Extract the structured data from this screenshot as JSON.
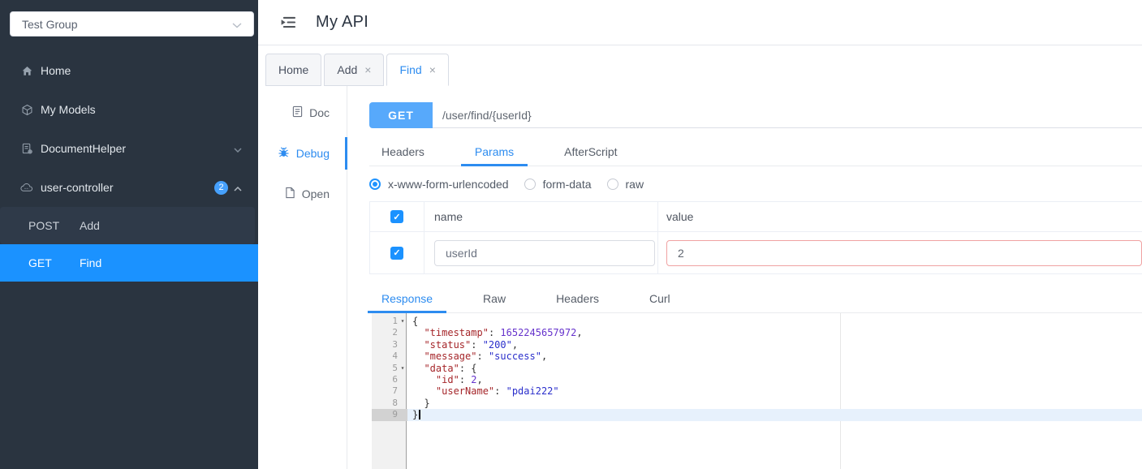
{
  "icons": {
    "close": "×",
    "check": "✓",
    "fold_marker": "▾"
  },
  "colors": {
    "sidebar_bg": "#2a3440",
    "submenu_item_bg": "#2f3a49",
    "sidebar_active_bg": "#1b92ff",
    "accent_blue": "#2d8cf0",
    "method_button_bg": "#57a9fb",
    "checkbox_blue": "#1b92ff",
    "badge_blue": "#46a0fc",
    "error_input_border": "#f0a2a2",
    "active_line_bg": "#e7f1fc",
    "syntax_key": "#a5262a",
    "syntax_string": "#2a2ecb",
    "syntax_number": "#6633cc"
  },
  "sidebar": {
    "group_select": {
      "value": "Test Group"
    },
    "items": [
      {
        "label": "Home"
      },
      {
        "label": "My Models"
      },
      {
        "label": "DocumentHelper",
        "chevron": "down"
      },
      {
        "label": "user-controller",
        "badge": "2",
        "chevron": "up"
      }
    ],
    "submenu": [
      {
        "method": "POST",
        "label": "Add",
        "active": false
      },
      {
        "method": "GET",
        "label": "Find",
        "active": true
      }
    ]
  },
  "header": {
    "title": "My API"
  },
  "tabs": [
    {
      "label": "Home",
      "closable": false,
      "active": false
    },
    {
      "label": "Add",
      "closable": true,
      "active": false
    },
    {
      "label": "Find",
      "closable": true,
      "active": true
    }
  ],
  "side_nav": [
    {
      "label": "Doc",
      "active": false
    },
    {
      "label": "Debug",
      "active": true
    },
    {
      "label": "Open",
      "active": false
    }
  ],
  "request": {
    "method": "GET",
    "url": "/user/find/{userId}",
    "tabs": [
      {
        "label": "Headers",
        "active": false
      },
      {
        "label": "Params",
        "active": true
      },
      {
        "label": "AfterScript",
        "active": false
      }
    ],
    "body_types": [
      {
        "label": "x-www-form-urlencoded",
        "selected": true
      },
      {
        "label": "form-data",
        "selected": false
      },
      {
        "label": "raw",
        "selected": false
      }
    ],
    "params_table": {
      "columns": [
        "name",
        "value"
      ],
      "rows": [
        {
          "checked": true,
          "name": "userId",
          "value": "2",
          "value_error": true
        }
      ]
    }
  },
  "response": {
    "tabs": [
      {
        "label": "Response",
        "active": true
      },
      {
        "label": "Raw",
        "active": false
      },
      {
        "label": "Headers",
        "active": false
      },
      {
        "label": "Curl",
        "active": false
      }
    ],
    "editor": {
      "active_line": 9,
      "lines": [
        {
          "no": 1,
          "fold": true,
          "tokens": [
            {
              "t": "p",
              "v": "{"
            }
          ]
        },
        {
          "no": 2,
          "tokens": [
            {
              "t": "w",
              "v": "  "
            },
            {
              "t": "k",
              "v": "\"timestamp\""
            },
            {
              "t": "p",
              "v": ": "
            },
            {
              "t": "n",
              "v": "1652245657972"
            },
            {
              "t": "p",
              "v": ","
            }
          ]
        },
        {
          "no": 3,
          "tokens": [
            {
              "t": "w",
              "v": "  "
            },
            {
              "t": "k",
              "v": "\"status\""
            },
            {
              "t": "p",
              "v": ": "
            },
            {
              "t": "s",
              "v": "\"200\""
            },
            {
              "t": "p",
              "v": ","
            }
          ]
        },
        {
          "no": 4,
          "tokens": [
            {
              "t": "w",
              "v": "  "
            },
            {
              "t": "k",
              "v": "\"message\""
            },
            {
              "t": "p",
              "v": ": "
            },
            {
              "t": "s",
              "v": "\"success\""
            },
            {
              "t": "p",
              "v": ","
            }
          ]
        },
        {
          "no": 5,
          "fold": true,
          "tokens": [
            {
              "t": "w",
              "v": "  "
            },
            {
              "t": "k",
              "v": "\"data\""
            },
            {
              "t": "p",
              "v": ": {"
            }
          ]
        },
        {
          "no": 6,
          "tokens": [
            {
              "t": "w",
              "v": "    "
            },
            {
              "t": "k",
              "v": "\"id\""
            },
            {
              "t": "p",
              "v": ": "
            },
            {
              "t": "n",
              "v": "2"
            },
            {
              "t": "p",
              "v": ","
            }
          ]
        },
        {
          "no": 7,
          "tokens": [
            {
              "t": "w",
              "v": "    "
            },
            {
              "t": "k",
              "v": "\"userName\""
            },
            {
              "t": "p",
              "v": ": "
            },
            {
              "t": "s",
              "v": "\"pdai222\""
            }
          ]
        },
        {
          "no": 8,
          "tokens": [
            {
              "t": "w",
              "v": "  "
            },
            {
              "t": "p",
              "v": "}"
            }
          ]
        },
        {
          "no": 9,
          "active": true,
          "cursor": true,
          "tokens": [
            {
              "t": "p",
              "v": "}"
            }
          ]
        }
      ]
    }
  }
}
